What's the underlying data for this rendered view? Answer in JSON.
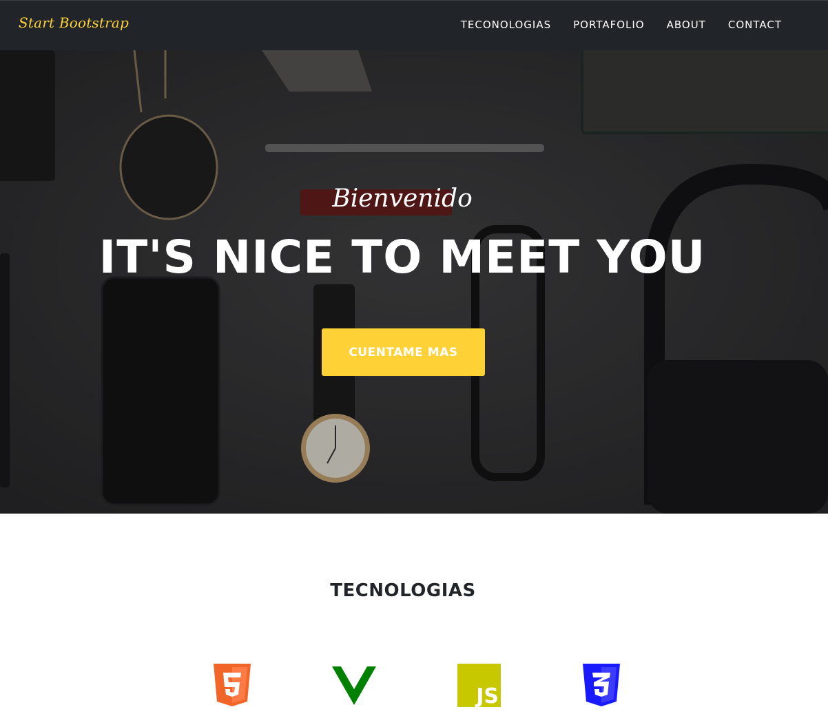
{
  "navbar": {
    "brand": "Start Bootstrap",
    "items": [
      {
        "label": "TECONOLOGIAS"
      },
      {
        "label": "PORTAFOLIO"
      },
      {
        "label": "ABOUT"
      },
      {
        "label": "CONTACT"
      }
    ]
  },
  "hero": {
    "lead_in": "Bienvenido",
    "heading": "IT'S NICE TO MEET YOU",
    "button_label": "CUENTAME MAS"
  },
  "technologies": {
    "title": "TECNOLOGIAS",
    "icons": [
      {
        "name": "html5-icon",
        "color": "#f16529"
      },
      {
        "name": "vue-icon",
        "color": "#008000"
      },
      {
        "name": "js-icon",
        "label": "JS",
        "color": "#c8c800"
      },
      {
        "name": "css3-icon",
        "color": "#1a1aff"
      }
    ]
  },
  "colors": {
    "navbar_bg": "#212529",
    "accent": "#fed136",
    "heading_text": "#212529"
  }
}
